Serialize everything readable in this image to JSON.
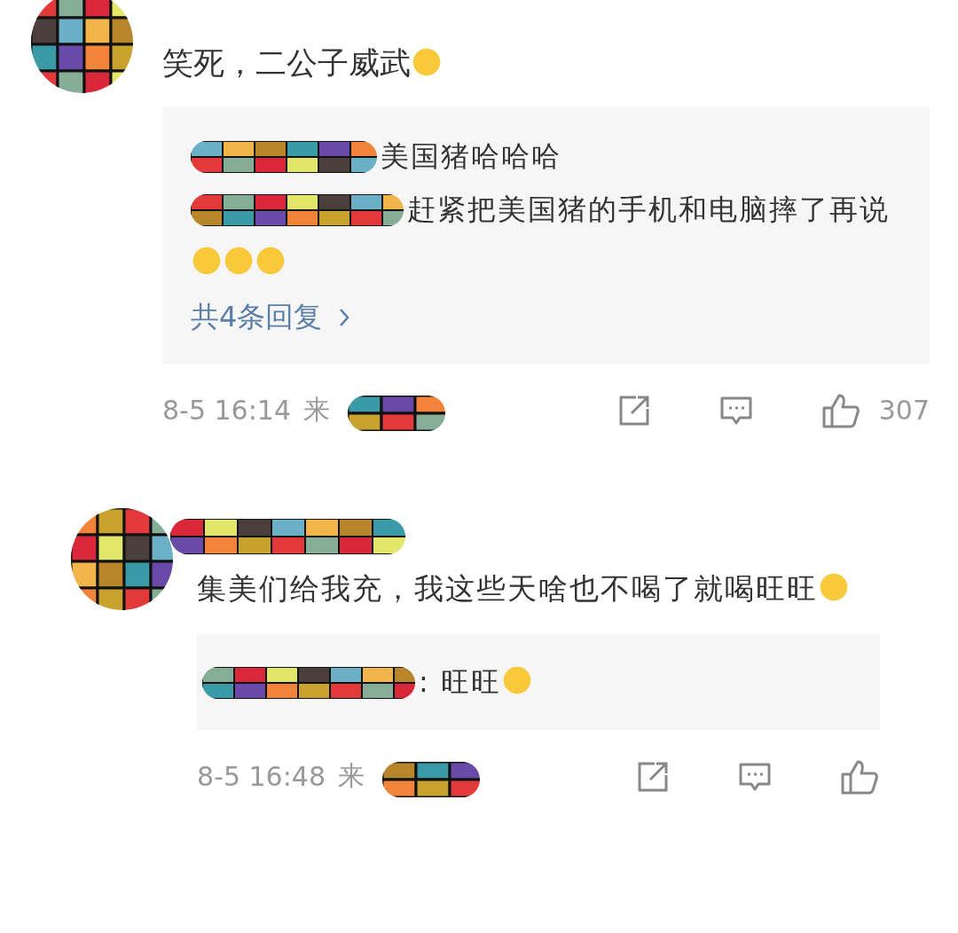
{
  "comments": [
    {
      "content": [
        {
          "kind": "text",
          "text": "笑死，二公子威武"
        },
        {
          "kind": "emoji"
        }
      ],
      "replies": [
        {
          "content": [
            {
              "kind": "text",
              "text": "美国猪哈哈哈"
            }
          ]
        },
        {
          "content": [
            {
              "kind": "text",
              "text": "赶紧把美国猪的手机和电脑摔了再说"
            },
            {
              "kind": "emoji"
            },
            {
              "kind": "emoji"
            },
            {
              "kind": "emoji"
            }
          ]
        }
      ],
      "more_replies": "共4条回复",
      "meta": {
        "time": "8-5 16:14",
        "source": "来",
        "likes": "307"
      }
    },
    {
      "content": [
        {
          "kind": "text",
          "text": "集美们给我充，我这些天啥也不喝了就喝旺旺"
        },
        {
          "kind": "emoji"
        }
      ],
      "replies": [
        {
          "content": [
            {
              "kind": "text",
              "text": ": 旺旺"
            },
            {
              "kind": "emoji"
            }
          ]
        }
      ],
      "meta": {
        "time": "8-5 16:48",
        "source": "来"
      }
    }
  ]
}
